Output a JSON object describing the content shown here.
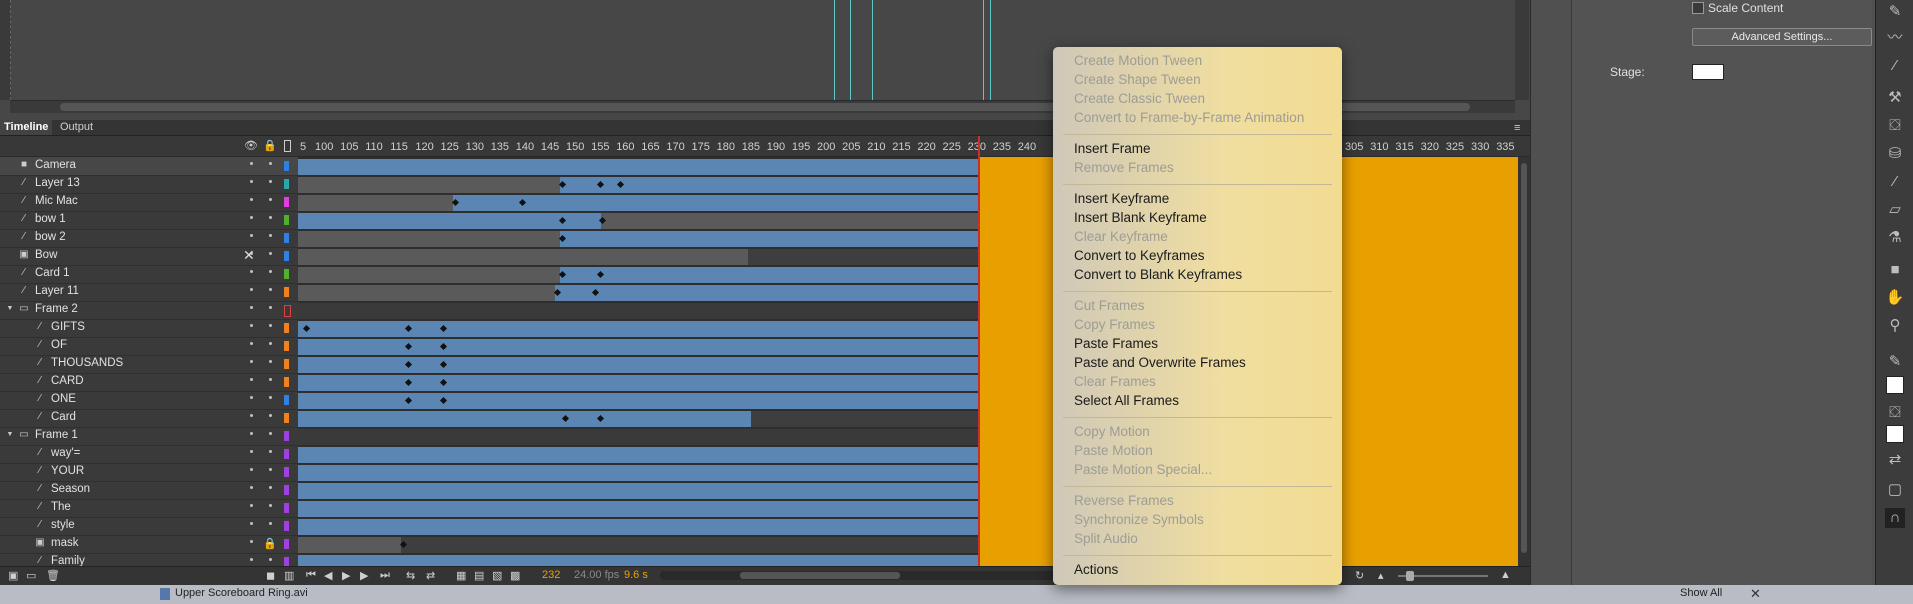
{
  "timeline": {
    "tab_active": "Timeline",
    "tab_other": "Output",
    "layers": [
      {
        "name": "Camera",
        "color": "#2f7fe0"
      },
      {
        "name": "Layer 13",
        "color": "#2aa8a8"
      },
      {
        "name": "Mic Mac",
        "color": "#e040e0"
      },
      {
        "name": "bow 1",
        "color": "#50b030"
      },
      {
        "name": "bow 2",
        "color": "#3080e0"
      },
      {
        "name": "Bow",
        "color": "#3080e0"
      },
      {
        "name": "Card 1",
        "color": "#50b030"
      },
      {
        "name": "Layer 11",
        "color": "#f08020"
      },
      {
        "name": "Frame 2",
        "color": "#e04040"
      },
      {
        "name": "GIFTS",
        "color": "#f08020"
      },
      {
        "name": "OF",
        "color": "#f08020"
      },
      {
        "name": "THOUSANDS",
        "color": "#f08020"
      },
      {
        "name": "CARD",
        "color": "#f08020"
      },
      {
        "name": "ONE",
        "color": "#3080e0"
      },
      {
        "name": "Card",
        "color": "#f08020"
      },
      {
        "name": "Frame 1",
        "color": "#a040e0"
      },
      {
        "name": "way'=",
        "color": "#a040e0"
      },
      {
        "name": "YOUR",
        "color": "#a040e0"
      },
      {
        "name": "Season",
        "color": "#a040e0"
      },
      {
        "name": "The",
        "color": "#a040e0"
      },
      {
        "name": "style",
        "color": "#a040e0"
      },
      {
        "name": "mask",
        "color": "#a040e0"
      },
      {
        "name": "Family",
        "color": "#a040e0"
      }
    ],
    "ruler_start_label": "5",
    "ruler": [
      "100",
      "105",
      "110",
      "115",
      "120",
      "125",
      "130",
      "135",
      "140",
      "145",
      "150",
      "155",
      "160",
      "165",
      "170",
      "175",
      "180",
      "185",
      "190",
      "195",
      "200",
      "205",
      "210",
      "215",
      "220",
      "225",
      "230",
      "235",
      "240",
      "305",
      "310",
      "315",
      "320",
      "325",
      "330",
      "335"
    ],
    "current_frame": "232",
    "fps": "24.00 fps",
    "time": "9.6 s"
  },
  "properties": {
    "scale_content": "Scale Content",
    "advanced_settings": "Advanced Settings...",
    "stage_label": "Stage:"
  },
  "context_menu": {
    "groups": [
      [
        {
          "label": "Create Motion Tween",
          "enabled": false
        },
        {
          "label": "Create Shape Tween",
          "enabled": false
        },
        {
          "label": "Create Classic Tween",
          "enabled": false
        },
        {
          "label": "Convert to Frame-by-Frame Animation",
          "enabled": false
        }
      ],
      [
        {
          "label": "Insert Frame",
          "enabled": true
        },
        {
          "label": "Remove Frames",
          "enabled": false
        }
      ],
      [
        {
          "label": "Insert Keyframe",
          "enabled": true
        },
        {
          "label": "Insert Blank Keyframe",
          "enabled": true
        },
        {
          "label": "Clear Keyframe",
          "enabled": false
        },
        {
          "label": "Convert to Keyframes",
          "enabled": true
        },
        {
          "label": "Convert to Blank Keyframes",
          "enabled": true
        }
      ],
      [
        {
          "label": "Cut Frames",
          "enabled": false
        },
        {
          "label": "Copy Frames",
          "enabled": false
        },
        {
          "label": "Paste Frames",
          "enabled": true
        },
        {
          "label": "Paste and Overwrite Frames",
          "enabled": true
        },
        {
          "label": "Clear Frames",
          "enabled": false
        },
        {
          "label": "Select All Frames",
          "enabled": true
        }
      ],
      [
        {
          "label": "Copy Motion",
          "enabled": false
        },
        {
          "label": "Paste Motion",
          "enabled": false
        },
        {
          "label": "Paste Motion Special...",
          "enabled": false
        }
      ],
      [
        {
          "label": "Reverse Frames",
          "enabled": false
        },
        {
          "label": "Synchronize Symbols",
          "enabled": false
        },
        {
          "label": "Split Audio",
          "enabled": false
        }
      ],
      [
        {
          "label": "Actions",
          "enabled": true
        }
      ]
    ]
  },
  "dock": {
    "document": "Upper Scoreboard Ring.avi",
    "show_all": "Show All"
  }
}
